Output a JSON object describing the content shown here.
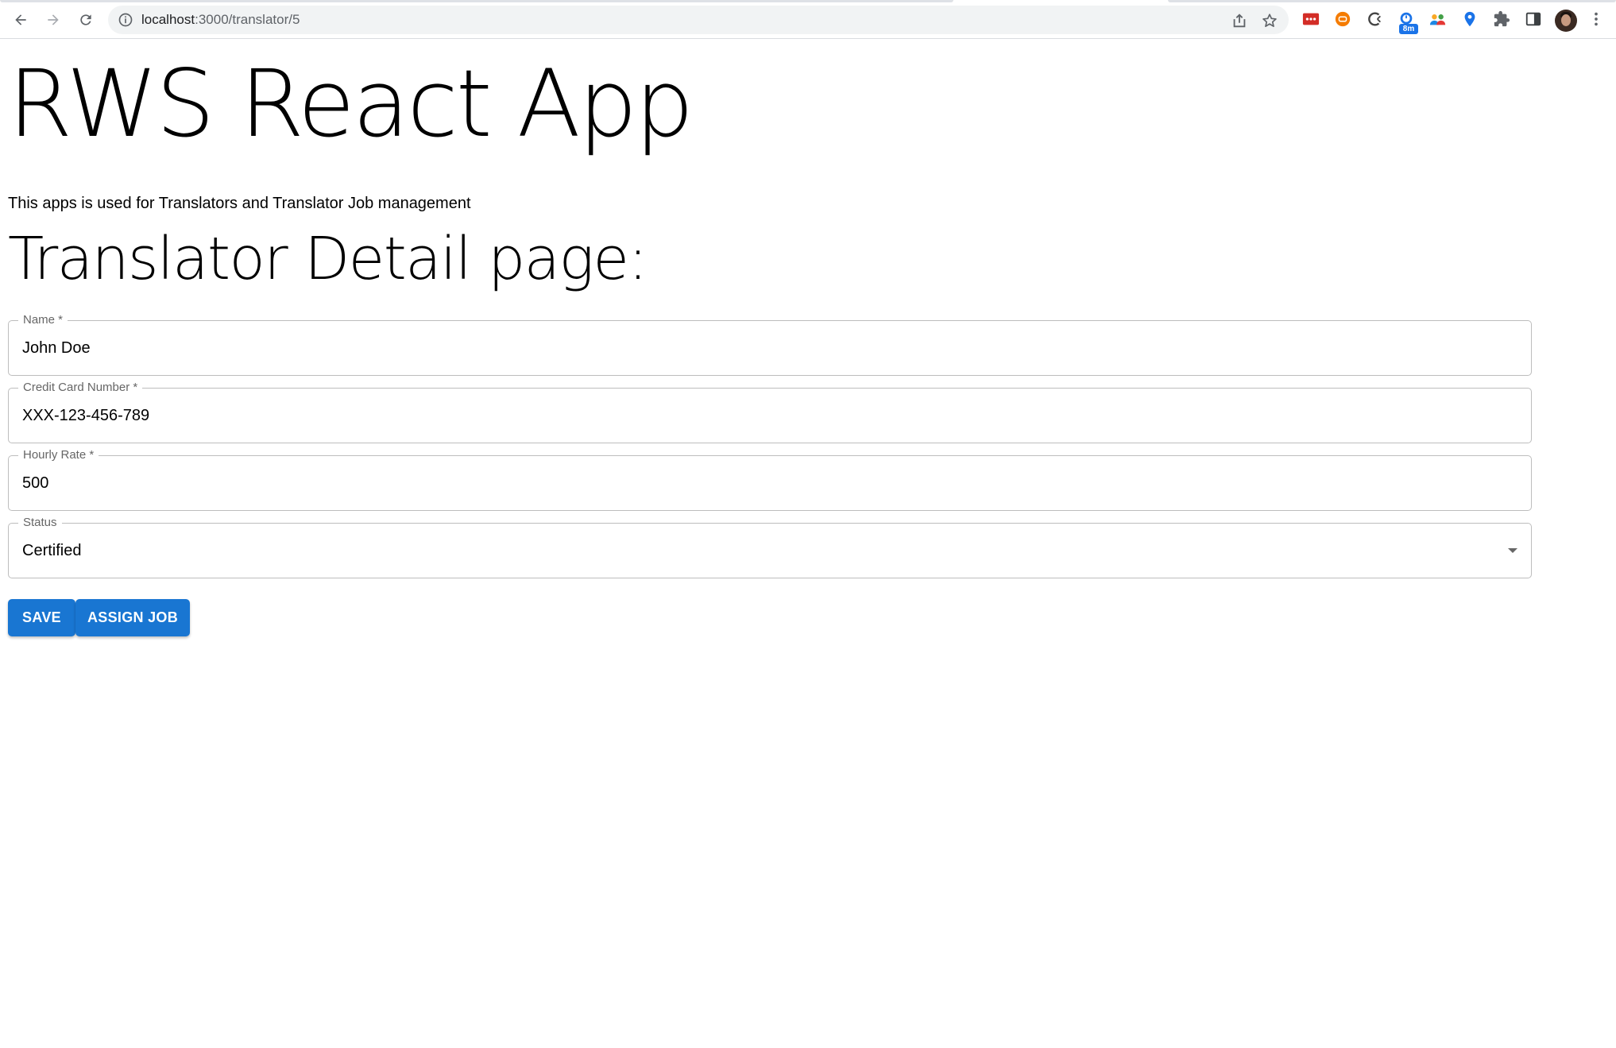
{
  "browser": {
    "url_host": "localhost",
    "url_path": ":3000/translator/5",
    "extension_badge": "8m"
  },
  "app": {
    "title": "RWS React App",
    "description": "This apps is used for Translators and Translator Job management",
    "page_heading": "Translator Detail page:"
  },
  "form": {
    "name": {
      "label": "Name *",
      "value": "John Doe"
    },
    "credit_card": {
      "label": "Credit Card Number *",
      "value": "XXX-123-456-789"
    },
    "hourly_rate": {
      "label": "Hourly Rate *",
      "value": "500"
    },
    "status": {
      "label": "Status",
      "value": "Certified"
    }
  },
  "actions": {
    "save_label": "SAVE",
    "assign_job_label": "ASSIGN JOB"
  },
  "colors": {
    "primary_button": "#1976d2",
    "field_border": "#bdbdbd"
  }
}
